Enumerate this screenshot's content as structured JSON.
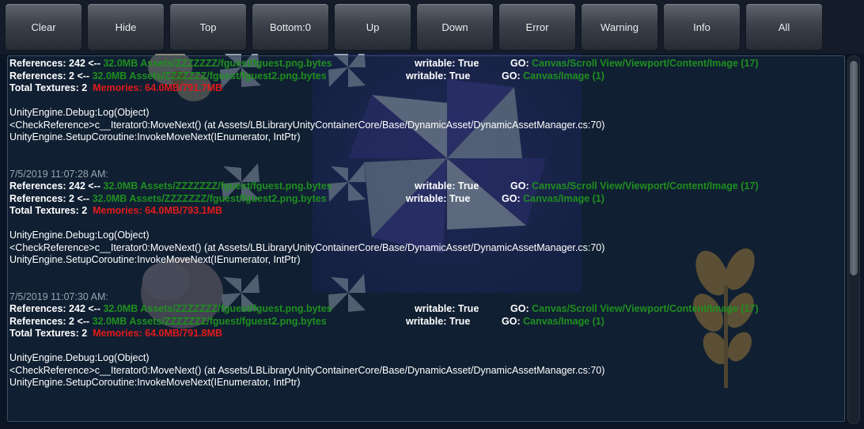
{
  "toolbar": {
    "buttons": [
      {
        "label": "Clear"
      },
      {
        "label": "Hide"
      },
      {
        "label": "Top"
      },
      {
        "label": "Bottom:0"
      },
      {
        "label": "Up"
      },
      {
        "label": "Down"
      },
      {
        "label": "Error"
      },
      {
        "label": "Warning"
      },
      {
        "label": "Info"
      },
      {
        "label": "All"
      }
    ]
  },
  "entries": [
    {
      "timestamp": "",
      "refs": [
        {
          "prefix": "References: 242 <-- ",
          "detail": "32.0MB Assets/ZZZZZZZ/fguest/fguest.png.bytes",
          "writable": "writable: True",
          "go_label": "GO: ",
          "go_path": "Canvas/Scroll View/Viewport/Content/Image (17)"
        },
        {
          "prefix": "References: 2 <-- ",
          "detail": "32.0MB Assets/ZZZZZZZ/fguest/fguest2.png.bytes",
          "writable": "writable: True",
          "go_label": "GO: ",
          "go_path": "Canvas/Image (1)"
        }
      ],
      "total_label": "Total Textures: 2",
      "memories": "Memories: 64.0MB/791.7MB",
      "stack": [
        "UnityEngine.Debug:Log(Object)",
        "<CheckReference>c__Iterator0:MoveNext() (at Assets/LBLibraryUnityContainerCore/Base/DynamicAsset/DynamicAssetManager.cs:70)",
        "UnityEngine.SetupCoroutine:InvokeMoveNext(IEnumerator, IntPtr)"
      ]
    },
    {
      "timestamp": "7/5/2019 11:07:28 AM:",
      "refs": [
        {
          "prefix": "References: 242 <-- ",
          "detail": "32.0MB Assets/ZZZZZZZ/fguest/fguest.png.bytes",
          "writable": "writable: True",
          "go_label": "GO: ",
          "go_path": "Canvas/Scroll View/Viewport/Content/Image (17)"
        },
        {
          "prefix": "References: 2 <-- ",
          "detail": "32.0MB Assets/ZZZZZZZ/fguest/fguest2.png.bytes",
          "writable": "writable: True",
          "go_label": "GO: ",
          "go_path": "Canvas/Image (1)"
        }
      ],
      "total_label": "Total Textures: 2",
      "memories": "Memories: 64.0MB/793.1MB",
      "stack": [
        "UnityEngine.Debug:Log(Object)",
        "<CheckReference>c__Iterator0:MoveNext() (at Assets/LBLibraryUnityContainerCore/Base/DynamicAsset/DynamicAssetManager.cs:70)",
        "UnityEngine.SetupCoroutine:InvokeMoveNext(IEnumerator, IntPtr)"
      ]
    },
    {
      "timestamp": "7/5/2019 11:07:30 AM:",
      "refs": [
        {
          "prefix": "References: 242 <-- ",
          "detail": "32.0MB Assets/ZZZZZZZ/fguest/fguest.png.bytes",
          "writable": "writable: True",
          "go_label": "GO: ",
          "go_path": "Canvas/Scroll View/Viewport/Content/Image (17)"
        },
        {
          "prefix": "References: 2 <-- ",
          "detail": "32.0MB Assets/ZZZZZZZ/fguest/fguest2.png.bytes",
          "writable": "writable: True",
          "go_label": "GO: ",
          "go_path": "Canvas/Image (1)"
        }
      ],
      "total_label": "Total Textures: 2",
      "memories": "Memories: 64.0MB/791.8MB",
      "stack": [
        "UnityEngine.Debug:Log(Object)",
        "<CheckReference>c__Iterator0:MoveNext() (at Assets/LBLibraryUnityContainerCore/Base/DynamicAsset/DynamicAssetManager.cs:70)",
        "UnityEngine.SetupCoroutine:InvokeMoveNext(IEnumerator, IntPtr)"
      ]
    }
  ],
  "colors": {
    "detail_green": "#1f8f1f",
    "memory_red": "#e01b1b",
    "timestamp_grey": "#9aa3ad",
    "background": "#0b1524"
  },
  "scrollbar": {
    "thumb_fraction": 0.6
  }
}
